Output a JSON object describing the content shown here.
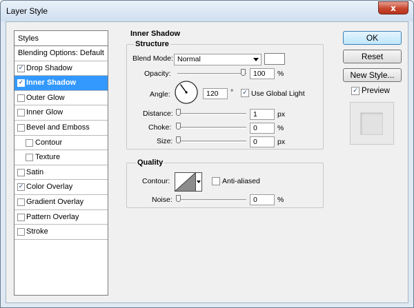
{
  "window": {
    "title": "Layer Style",
    "close_glyph": "x"
  },
  "styles_list": {
    "header": "Styles",
    "items": [
      {
        "label": "Blending Options: Default",
        "checkbox": false,
        "checked": false,
        "selected": false,
        "sub": false
      },
      {
        "label": "Drop Shadow",
        "checkbox": true,
        "checked": true,
        "selected": false,
        "sub": false
      },
      {
        "label": "Inner Shadow",
        "checkbox": true,
        "checked": true,
        "selected": true,
        "sub": false
      },
      {
        "label": "Outer Glow",
        "checkbox": true,
        "checked": false,
        "selected": false,
        "sub": false
      },
      {
        "label": "Inner Glow",
        "checkbox": true,
        "checked": false,
        "selected": false,
        "sub": false
      },
      {
        "label": "Bevel and Emboss",
        "checkbox": true,
        "checked": false,
        "selected": false,
        "sub": false
      },
      {
        "label": "Contour",
        "checkbox": true,
        "checked": false,
        "selected": false,
        "sub": true
      },
      {
        "label": "Texture",
        "checkbox": true,
        "checked": false,
        "selected": false,
        "sub": true
      },
      {
        "label": "Satin",
        "checkbox": true,
        "checked": false,
        "selected": false,
        "sub": false
      },
      {
        "label": "Color Overlay",
        "checkbox": true,
        "checked": true,
        "selected": false,
        "sub": false
      },
      {
        "label": "Gradient Overlay",
        "checkbox": true,
        "checked": false,
        "selected": false,
        "sub": false
      },
      {
        "label": "Pattern Overlay",
        "checkbox": true,
        "checked": false,
        "selected": false,
        "sub": false
      },
      {
        "label": "Stroke",
        "checkbox": true,
        "checked": false,
        "selected": false,
        "sub": false
      }
    ]
  },
  "inner_shadow": {
    "section_title": "Inner Shadow",
    "structure": {
      "legend": "Structure",
      "blend_mode_label": "Blend Mode:",
      "blend_mode_value": "Normal",
      "blend_color": "#ffffff",
      "opacity_label": "Opacity:",
      "opacity_value": "100",
      "opacity_unit": "%",
      "angle_label": "Angle:",
      "angle_value": "120",
      "angle_unit": "°",
      "use_global_light_label": "Use Global Light",
      "use_global_light_checked": true,
      "distance_label": "Distance:",
      "distance_value": "1",
      "distance_unit": "px",
      "choke_label": "Choke:",
      "choke_value": "0",
      "choke_unit": "%",
      "size_label": "Size:",
      "size_value": "0",
      "size_unit": "px"
    },
    "quality": {
      "legend": "Quality",
      "contour_label": "Contour:",
      "anti_aliased_label": "Anti-aliased",
      "anti_aliased_checked": false,
      "noise_label": "Noise:",
      "noise_value": "0",
      "noise_unit": "%"
    }
  },
  "buttons": {
    "ok": "OK",
    "reset": "Reset",
    "new_style": "New Style...",
    "preview_label": "Preview",
    "preview_checked": true
  },
  "check_glyph": "✓"
}
